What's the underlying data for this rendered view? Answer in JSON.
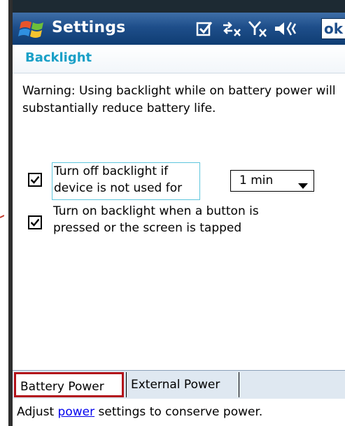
{
  "titlebar": {
    "title": "Settings",
    "ok_label": "ok",
    "icons": [
      "windows-start-icon",
      "checkbox-tray-icon",
      "connectivity-icon",
      "signal-off-icon",
      "volume-icon"
    ]
  },
  "header": {
    "title": "Backlight"
  },
  "warning_text": "Warning: Using backlight while on battery power will substantially reduce battery life.",
  "options": [
    {
      "label": "Turn off backlight if device is not used for",
      "checked": true
    },
    {
      "label": "Turn on backlight when a button is pressed or the screen is tapped",
      "checked": true
    }
  ],
  "timeout_select": {
    "value": "1 min"
  },
  "tabs": [
    {
      "label": "Battery Power",
      "selected": true
    },
    {
      "label": "External Power",
      "selected": false
    }
  ],
  "footer": {
    "prefix": "Adjust ",
    "link": "power",
    "suffix": " settings to conserve power."
  },
  "colors": {
    "titlebar": "#1e4e8a",
    "header_text": "#1aa0c7",
    "selected_tab_border": "#b3121a",
    "link": "#0000ee"
  }
}
